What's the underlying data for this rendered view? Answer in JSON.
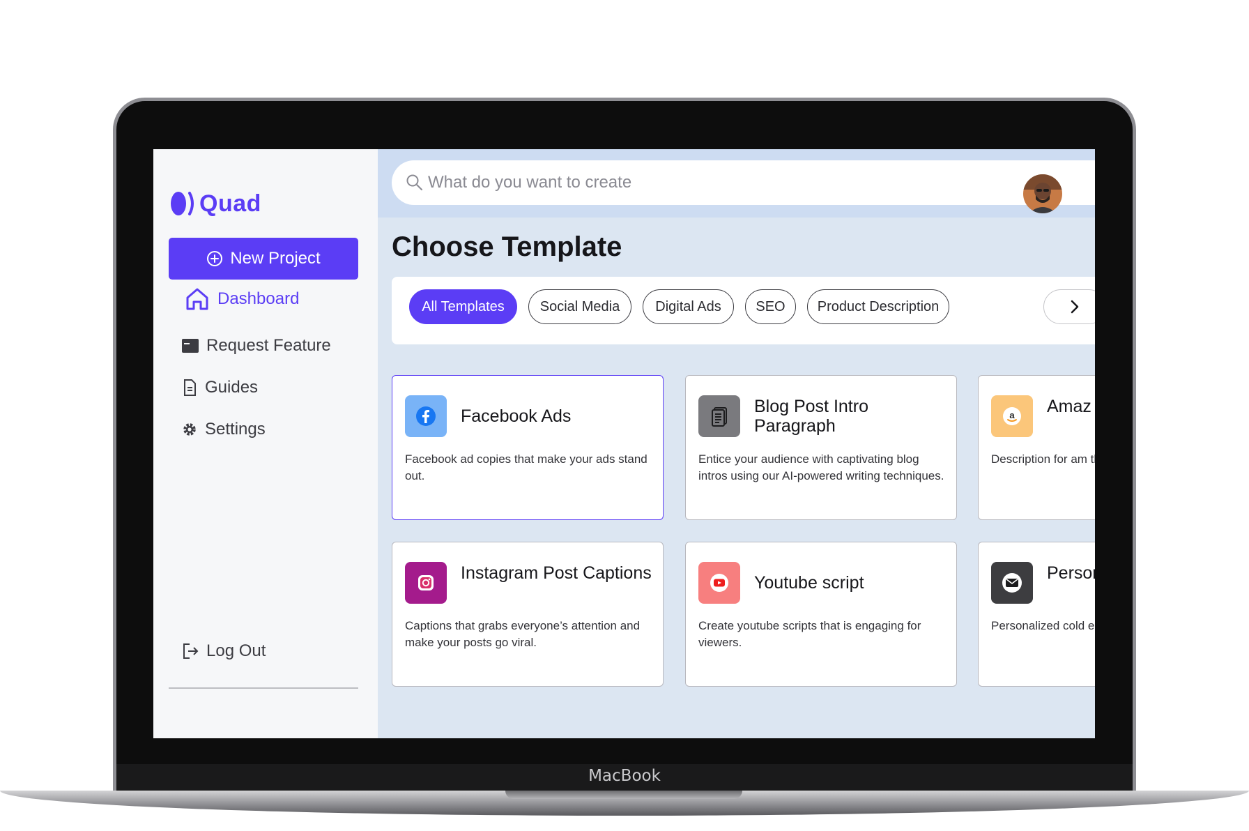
{
  "device": {
    "brand": "MacBook"
  },
  "sidebar": {
    "brand": "Quad",
    "new_project_label": "New Project",
    "nav": [
      {
        "label": "Dashboard",
        "icon": "home-icon",
        "active": true
      },
      {
        "label": "Request Feature",
        "icon": "window-icon",
        "active": false
      },
      {
        "label": "Guides",
        "icon": "document-icon",
        "active": false
      },
      {
        "label": "Settings",
        "icon": "gear-icon",
        "active": false
      }
    ],
    "logout_label": "Log Out"
  },
  "search": {
    "placeholder": "What do you want to create"
  },
  "main": {
    "title": "Choose Template",
    "filters": [
      "All Templates",
      "Social Media",
      "Digital Ads",
      "SEO",
      "Product Description"
    ],
    "active_filter": "All Templates"
  },
  "templates": [
    {
      "title": "Facebook Ads",
      "description": "Facebook  ad copies that make your ads stand out.",
      "icon": "facebook-icon",
      "icon_bg": "#79b3f7"
    },
    {
      "title": "Blog Post Intro Paragraph",
      "description": "Entice your audience with captivating blog intros using our AI-powered writing techniques.",
      "icon": "document-icon",
      "icon_bg": "#7a7a7e"
    },
    {
      "title": "Amaz Descri",
      "description": "Description for am the first page.",
      "icon": "amazon-icon",
      "icon_bg": "#fbc67a"
    },
    {
      "title": "Instagram Post Captions",
      "description": "Captions that grabs everyone’s attention and make your posts go viral.",
      "icon": "instagram-icon",
      "icon_bg": "#a41b8c"
    },
    {
      "title": "Youtube script",
      "description": "Create youtube scripts that is engaging for viewers.",
      "icon": "youtube-icon",
      "icon_bg": "#f77f7f"
    },
    {
      "title": "Person Emails",
      "description": "Personalized cold e your target audien",
      "icon": "mail-icon",
      "icon_bg": "#3d3d40"
    }
  ],
  "colors": {
    "accent": "#5b3df5",
    "main_bg": "#dce6f2",
    "topbar_bg": "#cddcf2",
    "sidebar_bg": "#f6f7f9"
  }
}
